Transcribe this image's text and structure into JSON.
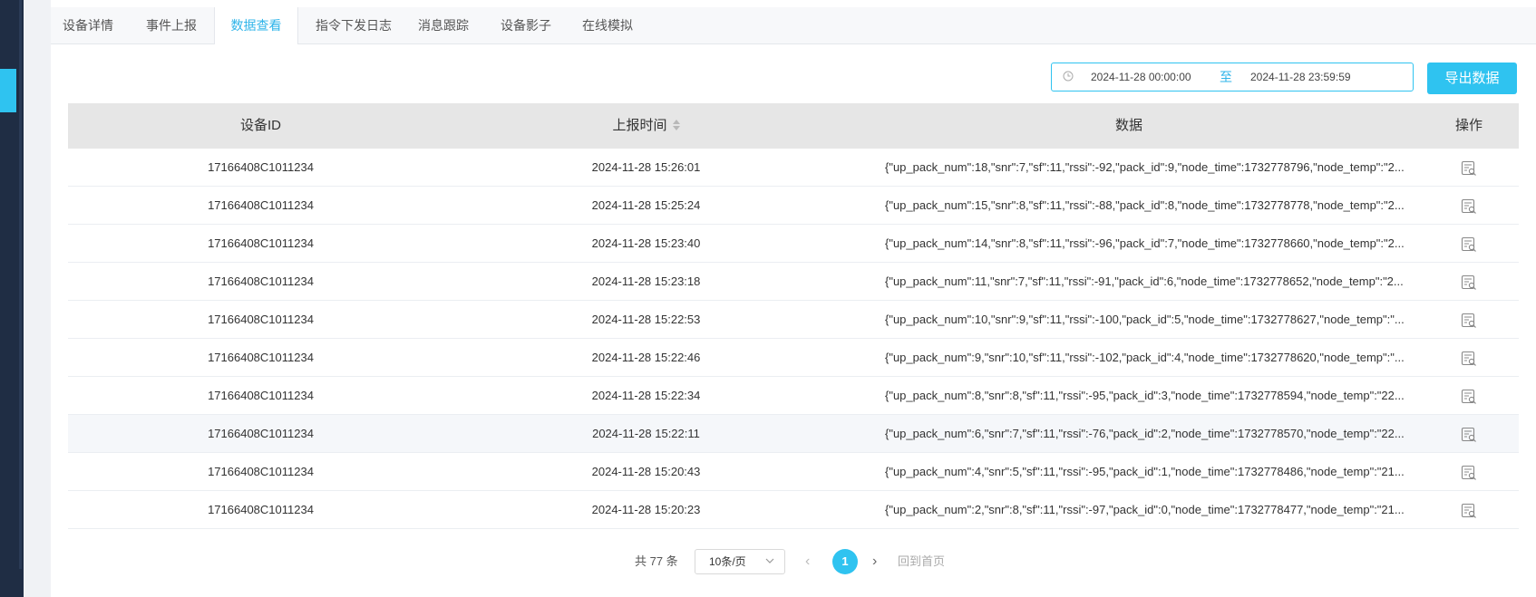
{
  "tabs": [
    {
      "label": "设备详情"
    },
    {
      "label": "事件上报"
    },
    {
      "label": "数据查看"
    },
    {
      "label": "指令下发日志"
    },
    {
      "label": "消息跟踪"
    },
    {
      "label": "设备影子"
    },
    {
      "label": "在线模拟"
    }
  ],
  "active_tab": "数据查看",
  "daterange": {
    "start": "2024-11-28 00:00:00",
    "separator": "至",
    "end": "2024-11-28 23:59:59"
  },
  "export_label": "导出数据",
  "table": {
    "headers": {
      "device_id": "设备ID",
      "report_time": "上报时间",
      "data": "数据",
      "action": "操作"
    },
    "rows": [
      {
        "device_id": "17166408C1011234",
        "time": "2024-11-28 15:26:01",
        "data": "{\"up_pack_num\":18,\"snr\":7,\"sf\":11,\"rssi\":-92,\"pack_id\":9,\"node_time\":1732778796,\"node_temp\":\"2..."
      },
      {
        "device_id": "17166408C1011234",
        "time": "2024-11-28 15:25:24",
        "data": "{\"up_pack_num\":15,\"snr\":8,\"sf\":11,\"rssi\":-88,\"pack_id\":8,\"node_time\":1732778778,\"node_temp\":\"2..."
      },
      {
        "device_id": "17166408C1011234",
        "time": "2024-11-28 15:23:40",
        "data": "{\"up_pack_num\":14,\"snr\":8,\"sf\":11,\"rssi\":-96,\"pack_id\":7,\"node_time\":1732778660,\"node_temp\":\"2..."
      },
      {
        "device_id": "17166408C1011234",
        "time": "2024-11-28 15:23:18",
        "data": "{\"up_pack_num\":11,\"snr\":7,\"sf\":11,\"rssi\":-91,\"pack_id\":6,\"node_time\":1732778652,\"node_temp\":\"2..."
      },
      {
        "device_id": "17166408C1011234",
        "time": "2024-11-28 15:22:53",
        "data": "{\"up_pack_num\":10,\"snr\":9,\"sf\":11,\"rssi\":-100,\"pack_id\":5,\"node_time\":1732778627,\"node_temp\":\"..."
      },
      {
        "device_id": "17166408C1011234",
        "time": "2024-11-28 15:22:46",
        "data": "{\"up_pack_num\":9,\"snr\":10,\"sf\":11,\"rssi\":-102,\"pack_id\":4,\"node_time\":1732778620,\"node_temp\":\"..."
      },
      {
        "device_id": "17166408C1011234",
        "time": "2024-11-28 15:22:34",
        "data": "{\"up_pack_num\":8,\"snr\":8,\"sf\":11,\"rssi\":-95,\"pack_id\":3,\"node_time\":1732778594,\"node_temp\":\"22..."
      },
      {
        "device_id": "17166408C1011234",
        "time": "2024-11-28 15:22:11",
        "data": "{\"up_pack_num\":6,\"snr\":7,\"sf\":11,\"rssi\":-76,\"pack_id\":2,\"node_time\":1732778570,\"node_temp\":\"22..."
      },
      {
        "device_id": "17166408C1011234",
        "time": "2024-11-28 15:20:43",
        "data": "{\"up_pack_num\":4,\"snr\":5,\"sf\":11,\"rssi\":-95,\"pack_id\":1,\"node_time\":1732778486,\"node_temp\":\"21..."
      },
      {
        "device_id": "17166408C1011234",
        "time": "2024-11-28 15:20:23",
        "data": "{\"up_pack_num\":2,\"snr\":8,\"sf\":11,\"rssi\":-97,\"pack_id\":0,\"node_time\":1732778477,\"node_temp\":\"21..."
      }
    ],
    "action_icon": "view-detail-icon"
  },
  "pagination": {
    "total_text": "共 77 条",
    "page_size": "10条/页",
    "current_page": "1",
    "home_label": "回到首页"
  },
  "colors": {
    "accent": "#2fc3f0",
    "sidebar": "#1f2d44"
  }
}
